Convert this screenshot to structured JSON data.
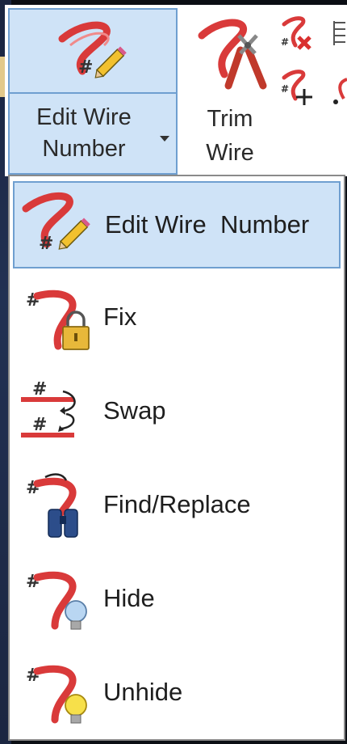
{
  "ribbon": {
    "edit_wire_number_label": "Edit Wire\nNumber",
    "trim_wire_label": "Trim\nWire"
  },
  "menu": {
    "items": [
      {
        "label": "Edit Wire  Number",
        "icon": "edit-wire-number-icon",
        "active": true
      },
      {
        "label": "Fix",
        "icon": "fix-wire-number-icon",
        "active": false
      },
      {
        "label": "Swap",
        "icon": "swap-wire-numbers-icon",
        "active": false
      },
      {
        "label": "Find/Replace",
        "icon": "find-replace-icon",
        "active": false
      },
      {
        "label": "Hide",
        "icon": "hide-wire-number-icon",
        "active": false
      },
      {
        "label": "Unhide",
        "icon": "unhide-wire-number-icon",
        "active": false
      }
    ]
  },
  "colors": {
    "accent_bg": "#cfe3f7",
    "accent_border": "#6f9fd0",
    "wire_red": "#d93a3a"
  }
}
